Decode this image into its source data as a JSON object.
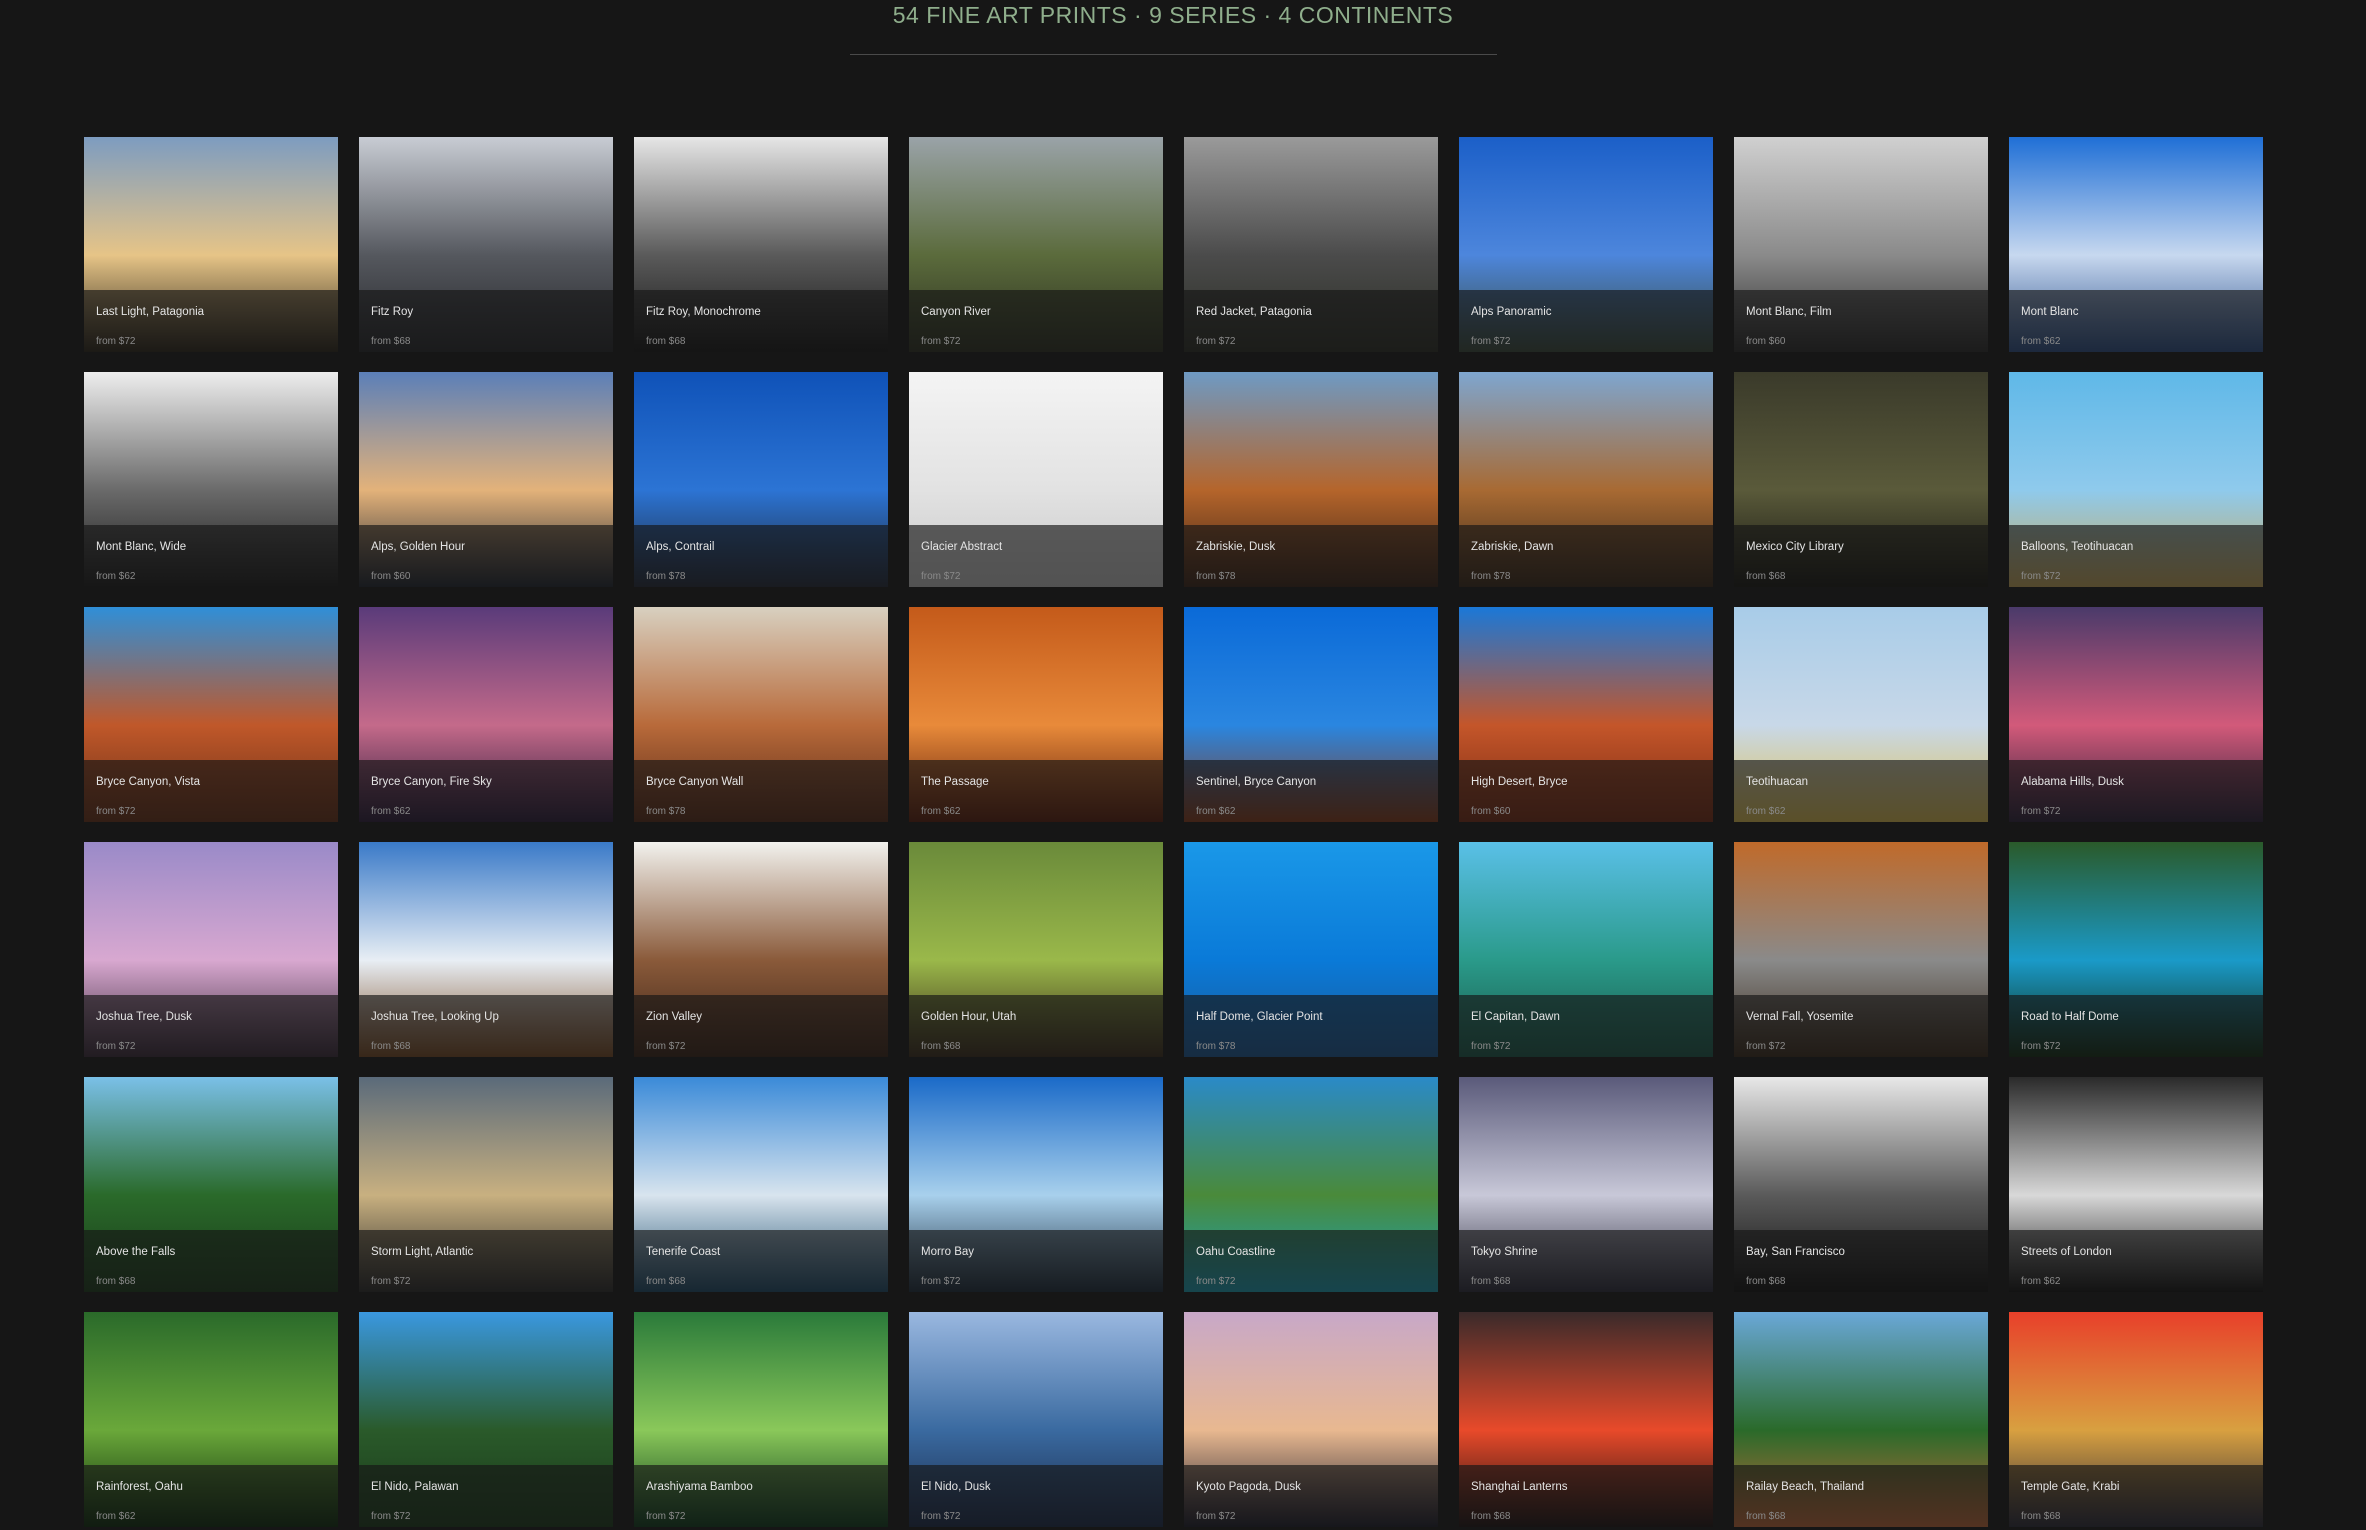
{
  "header": {
    "title": "54 FINE ART PRINTS · 9 SERIES · 4 CONTINENTS"
  },
  "prints": [
    {
      "title": "Last Light, Patagonia",
      "price": "from $72",
      "colors": [
        "#7d9cc0",
        "#e6c487",
        "#2a2418"
      ]
    },
    {
      "title": "Fitz Roy",
      "price": "from $68",
      "colors": [
        "#c8ccd4",
        "#55585e",
        "#25262a"
      ]
    },
    {
      "title": "Fitz Roy, Monochrome",
      "price": "from $68",
      "colors": [
        "#e6e6e6",
        "#5a5a5a",
        "#151515"
      ]
    },
    {
      "title": "Canyon River",
      "price": "from $72",
      "colors": [
        "#9aa3a8",
        "#5b6b3c",
        "#2c3020"
      ]
    },
    {
      "title": "Red Jacket, Patagonia",
      "price": "from $72",
      "colors": [
        "#9a9a9a",
        "#4b4b4b",
        "#2a2d24"
      ]
    },
    {
      "title": "Alps Panoramic",
      "price": "from $72",
      "colors": [
        "#1b5fc8",
        "#4d86dc",
        "#3a4a3a"
      ]
    },
    {
      "title": "Mont Blanc, Film",
      "price": "from $60",
      "colors": [
        "#d0d0d0",
        "#8a8a8a",
        "#2a2a2a"
      ]
    },
    {
      "title": "Mont Blanc",
      "price": "from $62",
      "colors": [
        "#1f6fd6",
        "#c7d8ef",
        "#2b4f8a"
      ]
    },
    {
      "title": "Mont Blanc, Wide",
      "price": "from $62",
      "colors": [
        "#eeeeee",
        "#6a6a6a",
        "#1a1a1a"
      ]
    },
    {
      "title": "Alps, Golden Hour",
      "price": "from $60",
      "colors": [
        "#5b7fb8",
        "#e3b27a",
        "#1d2430"
      ]
    },
    {
      "title": "Alps, Contrail",
      "price": "from $78",
      "colors": [
        "#0f52b8",
        "#2c74d4",
        "#202838"
      ]
    },
    {
      "title": "Glacier Abstract",
      "price": "from $72",
      "colors": [
        "#f4f4f4",
        "#e2e2e2",
        "#c8c8c8"
      ]
    },
    {
      "title": "Zabriskie, Dusk",
      "price": "from $78",
      "colors": [
        "#6e9ac4",
        "#b5652b",
        "#3a2216"
      ]
    },
    {
      "title": "Zabriskie, Dawn",
      "price": "from $78",
      "colors": [
        "#7ea6d0",
        "#a86a33",
        "#3a2818"
      ]
    },
    {
      "title": "Mexico City Library",
      "price": "from $68",
      "colors": [
        "#3a3a2a",
        "#5a5a3a",
        "#151510"
      ]
    },
    {
      "title": "Balloons, Teotihuacan",
      "price": "from $72",
      "colors": [
        "#5fb8e8",
        "#8fcaec",
        "#c9a85a"
      ]
    },
    {
      "title": "Bryce Canyon, Vista",
      "price": "from $72",
      "colors": [
        "#2f8fd8",
        "#c0582a",
        "#6b3016"
      ]
    },
    {
      "title": "Bryce Canyon, Fire Sky",
      "price": "from $62",
      "colors": [
        "#5a3b7a",
        "#c46a8a",
        "#2a1a3a"
      ]
    },
    {
      "title": "Bryce Canyon Wall",
      "price": "from $78",
      "colors": [
        "#d8d0c0",
        "#b86a3a",
        "#5a2a16"
      ]
    },
    {
      "title": "The Passage",
      "price": "from $62",
      "colors": [
        "#c45a1a",
        "#e88a3a",
        "#5a1a08"
      ]
    },
    {
      "title": "Sentinel, Bryce Canyon",
      "price": "from $62",
      "colors": [
        "#0a6ad8",
        "#2a86e0",
        "#8a3a18"
      ]
    },
    {
      "title": "High Desert, Bryce",
      "price": "from $60",
      "colors": [
        "#1a78d8",
        "#c4562a",
        "#7a2a12"
      ]
    },
    {
      "title": "Teotihuacan",
      "price": "from $62",
      "colors": [
        "#a8cce8",
        "#c8d8e8",
        "#e0c050"
      ]
    },
    {
      "title": "Alabama Hills, Dusk",
      "price": "from $72",
      "colors": [
        "#4a3a6a",
        "#d25a7a",
        "#2a1f3a"
      ]
    },
    {
      "title": "Joshua Tree, Dusk",
      "price": "from $72",
      "colors": [
        "#9a8ac8",
        "#d8a8d0",
        "#3a2a3a"
      ]
    },
    {
      "title": "Joshua Tree, Looking Up",
      "price": "from $68",
      "colors": [
        "#3a7ac8",
        "#e8eef4",
        "#7a4a22"
      ]
    },
    {
      "title": "Zion Valley",
      "price": "from $72",
      "colors": [
        "#f2f2ee",
        "#8a5a3a",
        "#3a2216"
      ]
    },
    {
      "title": "Golden Hour, Utah",
      "price": "from $68",
      "colors": [
        "#6a8a3a",
        "#9ab84a",
        "#3a2a1a"
      ]
    },
    {
      "title": "Half Dome, Glacier Point",
      "price": "from $78",
      "colors": [
        "#1a98e8",
        "#0a7ad8",
        "#1a5a9a"
      ]
    },
    {
      "title": "El Capitan, Dawn",
      "price": "from $72",
      "colors": [
        "#5ac0e8",
        "#2a9a8a",
        "#1a5a4a"
      ]
    },
    {
      "title": "Vernal Fall, Yosemite",
      "price": "from $72",
      "colors": [
        "#c06a2a",
        "#8a8a8a",
        "#3a2a1a"
      ]
    },
    {
      "title": "Road to Half Dome",
      "price": "from $72",
      "colors": [
        "#2a5a2a",
        "#1a9ac8",
        "#102a10"
      ]
    },
    {
      "title": "Above the Falls",
      "price": "from $68",
      "colors": [
        "#7ac0e8",
        "#2a6a2a",
        "#1a3a1a"
      ]
    },
    {
      "title": "Storm Light, Atlantic",
      "price": "from $72",
      "colors": [
        "#5a6a7a",
        "#c8b080",
        "#2a2a2a"
      ]
    },
    {
      "title": "Tenerife Coast",
      "price": "from $68",
      "colors": [
        "#3a8ad8",
        "#d8e4ee",
        "#1a4a6a"
      ]
    },
    {
      "title": "Morro Bay",
      "price": "from $72",
      "colors": [
        "#1a6ac8",
        "#a8d0ec",
        "#1a2a3a"
      ]
    },
    {
      "title": "Oahu Coastline",
      "price": "from $72",
      "colors": [
        "#2a8ac8",
        "#4a8a3a",
        "#1aa0b8"
      ]
    },
    {
      "title": "Tokyo Shrine",
      "price": "from $68",
      "colors": [
        "#5a5a7a",
        "#c8c8d8",
        "#2a2a3a"
      ]
    },
    {
      "title": "Bay, San Francisco",
      "price": "from $68",
      "colors": [
        "#e8e8e8",
        "#5a5a5a",
        "#101010"
      ]
    },
    {
      "title": "Streets of London",
      "price": "from $62",
      "colors": [
        "#2a2a2a",
        "#d8d8d8",
        "#101010"
      ]
    },
    {
      "title": "Rainforest, Oahu",
      "price": "from $62",
      "colors": [
        "#2a6a2a",
        "#6aa83a",
        "#0a2a0a"
      ]
    },
    {
      "title": "El Nido, Palawan",
      "price": "from $72",
      "colors": [
        "#3a98e0",
        "#2a5a2a",
        "#1a3a1a"
      ]
    },
    {
      "title": "Arashiyama Bamboo",
      "price": "from $72",
      "colors": [
        "#2a7a3a",
        "#8ac85a",
        "#0a3a1a"
      ]
    },
    {
      "title": "El Nido, Dusk",
      "price": "from $72",
      "colors": [
        "#9ab8e0",
        "#3a6aa0",
        "#1a2a4a"
      ]
    },
    {
      "title": "Kyoto Pagoda, Dusk",
      "price": "from $72",
      "colors": [
        "#c8a8c8",
        "#e8b890",
        "#1a1a2a"
      ]
    },
    {
      "title": "Shanghai Lanterns",
      "price": "from $68",
      "colors": [
        "#3a2a2a",
        "#e84a2a",
        "#1a1010"
      ]
    },
    {
      "title": "Railay Beach, Thailand",
      "price": "from $68",
      "colors": [
        "#6aa8d8",
        "#2a6a2a",
        "#c86a3a"
      ]
    },
    {
      "title": "Temple Gate, Krabi",
      "price": "from $68",
      "colors": [
        "#e8402a",
        "#d8a040",
        "#2a2a3a"
      ]
    }
  ]
}
